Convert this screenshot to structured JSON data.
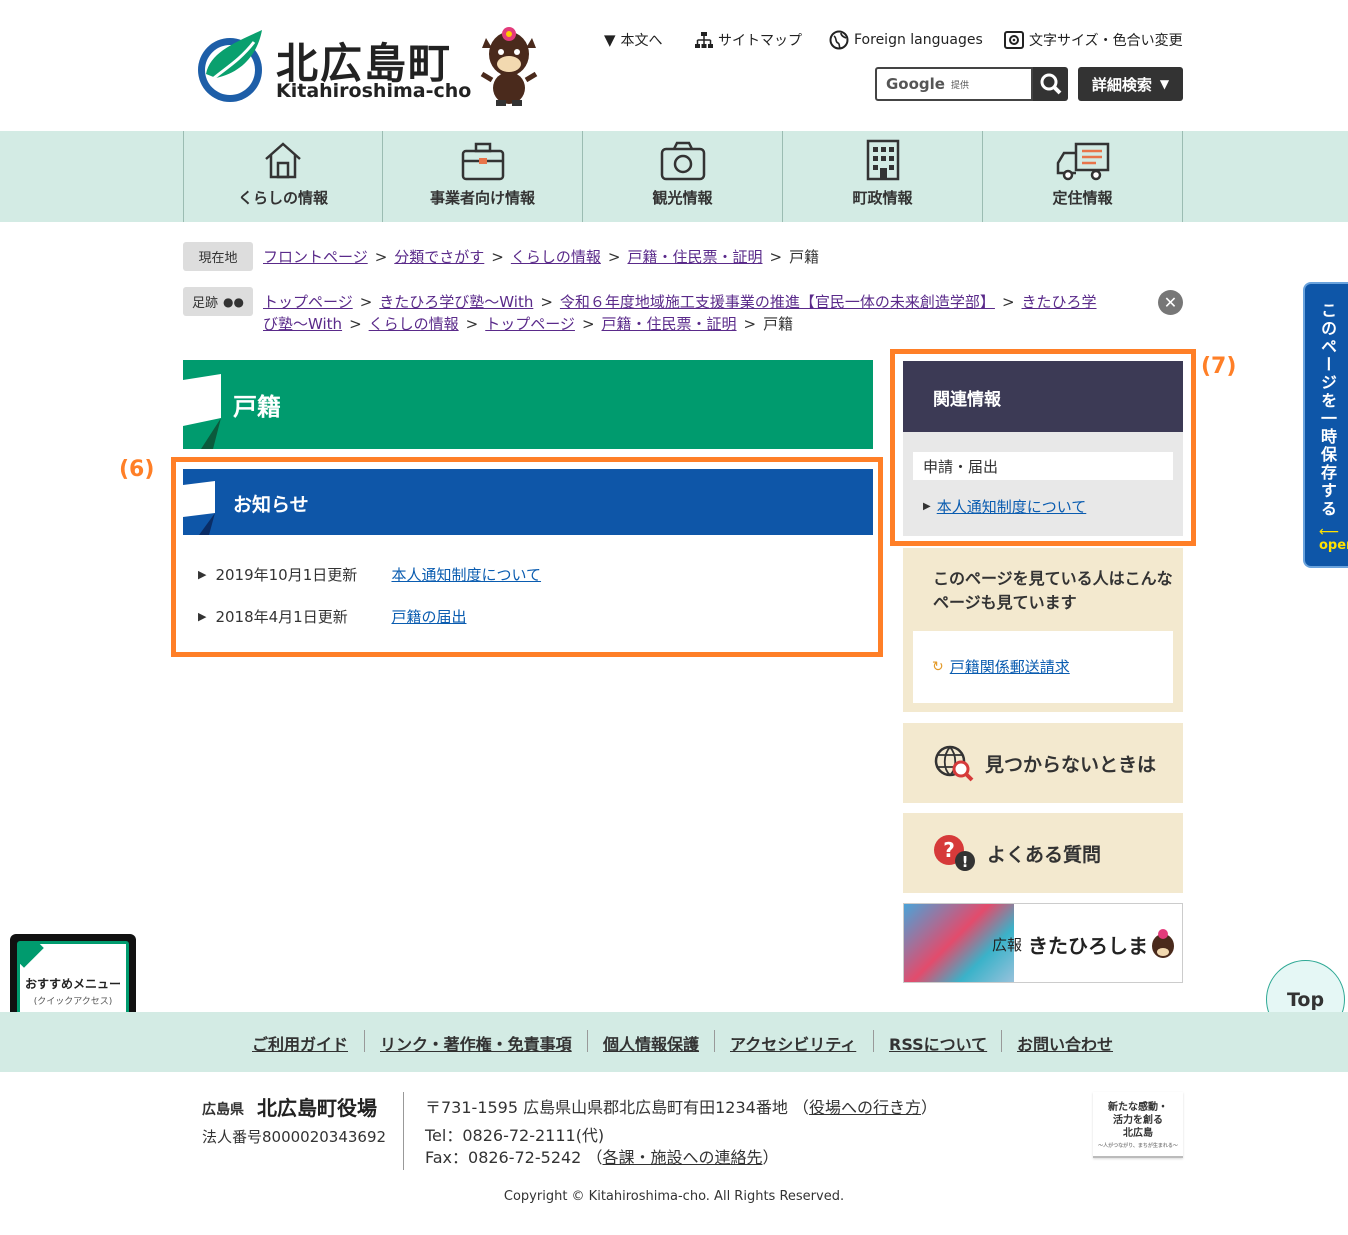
{
  "header": {
    "logo_jp": "北広島町",
    "logo_en": "Kitahiroshima-cho",
    "util_links": [
      {
        "label": "本文へ",
        "icon": "chevron-down-icon"
      },
      {
        "label": "サイトマップ",
        "icon": "sitemap-icon"
      },
      {
        "label": "Foreign languages",
        "icon": "globe-icon"
      },
      {
        "label": "文字サイズ・色合い変更",
        "icon": "gear-icon"
      }
    ],
    "search": {
      "brand": "Google",
      "provider": "提供"
    },
    "advanced_search": "詳細検索"
  },
  "gnav": [
    {
      "label": "くらしの情報",
      "icon": "house-icon"
    },
    {
      "label": "事業者向け情報",
      "icon": "briefcase-icon"
    },
    {
      "label": "観光情報",
      "icon": "camera-icon"
    },
    {
      "label": "町政情報",
      "icon": "building-icon"
    },
    {
      "label": "定住情報",
      "icon": "moving-truck-icon"
    }
  ],
  "breadcrumb": {
    "tag": "現在地",
    "items": [
      "フロントページ",
      "分類でさがす",
      "くらしの情報",
      "戸籍・住民票・証明"
    ],
    "current": "戸籍"
  },
  "trail": {
    "tag": "足跡",
    "line1": [
      "トップページ",
      "きたひろ学び塾～With",
      "令和６年度地域施工支援事業の推進【官民一体の未来創造学部】",
      "きたひろ学"
    ],
    "line2_first": "び塾～With",
    "line2": [
      "くらしの情報",
      "トップページ",
      "戸籍・住民票・証明"
    ],
    "current": "戸籍"
  },
  "page_title": "戸籍",
  "notice": {
    "label": "(6)",
    "heading": "お知らせ",
    "items": [
      {
        "date": "2019年10月1日更新",
        "title": "本人通知制度について"
      },
      {
        "date": "2018年4月1日更新",
        "title": "戸籍の届出"
      }
    ]
  },
  "related": {
    "label": "(7)",
    "heading": "関連情報",
    "category": "申請・届出",
    "link": "本人通知制度について"
  },
  "also_viewed": {
    "title": "このページを見ている人はこんなページも見ています",
    "link": "戸籍関係郵送請求"
  },
  "side_buttons": [
    {
      "label": "見つからないときは",
      "icon": "search-globe-icon"
    },
    {
      "label": "よくある質問",
      "icon": "question-icon"
    }
  ],
  "kouhou": {
    "prefix": "広報",
    "name": "きたひろしま"
  },
  "save_tab": {
    "text": "このページを一時保存する",
    "open": "open"
  },
  "top_button": "Top",
  "quick_menu": {
    "title": "おすすめメニュー",
    "sub": "(クイックアクセス)",
    "open": "open"
  },
  "footer": {
    "links": [
      "ご利用ガイド",
      "リンク・著作権・免責事項",
      "個人情報保護",
      "アクセシビリティ",
      "RSSについて",
      "お問い合わせ"
    ],
    "pref": "広島県",
    "office": "北広島町役場",
    "corp_no": "法人番号8000020343692",
    "address": "〒731-1595 広島県山県郡北広島町有田1234番地",
    "access_link": "役場への行き方",
    "tel": "Tel：0826-72-2111(代)",
    "fax": "Fax：0826-72-5242",
    "contacts_link": "各課・施設への連絡先",
    "banner": {
      "l1": "新たな感動・",
      "l2": "活力を創る",
      "l3": "北広島",
      "l4": "～人がつながり、まちが生まれる～"
    },
    "copyright": "Copyright © Kitahiroshima-cho. All Rights Reserved."
  },
  "colors": {
    "green": "#009b6e",
    "blue": "#0e56a8",
    "navy": "#3c3a55",
    "highlight": "#ff7f27",
    "mint": "#d3ebe4",
    "beige": "#f3e9cf"
  }
}
